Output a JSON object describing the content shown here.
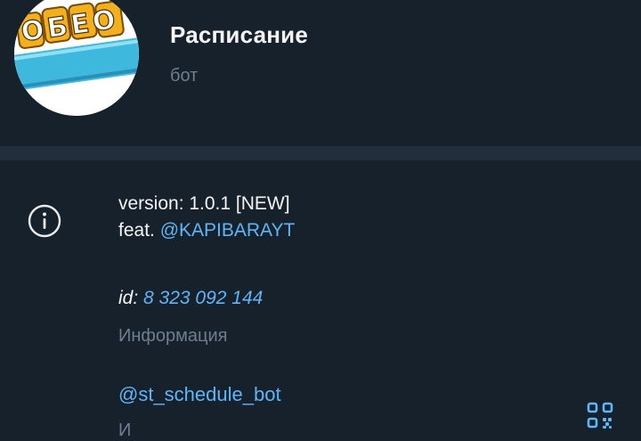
{
  "profile": {
    "avatar_text": "ОБЕО",
    "name": "Расписание",
    "subtitle": "бот"
  },
  "about": {
    "version_line": "version: 1.0.1 [NEW]",
    "feat_prefix": "feat. ",
    "feat_link": "@KAPIBARAYT",
    "id_label": "id:",
    "id_value": "8 323 092 144",
    "section_label": "Информация"
  },
  "username": {
    "value": "@st_schedule_bot",
    "label_partial": "И"
  },
  "icons": {
    "info": "info-icon",
    "qr": "qr-code-icon"
  },
  "colors": {
    "background": "#17212b",
    "divider": "#232e3c",
    "link": "#5eb5f7",
    "muted": "#6d7f8f",
    "text": "#f5f5f5"
  }
}
